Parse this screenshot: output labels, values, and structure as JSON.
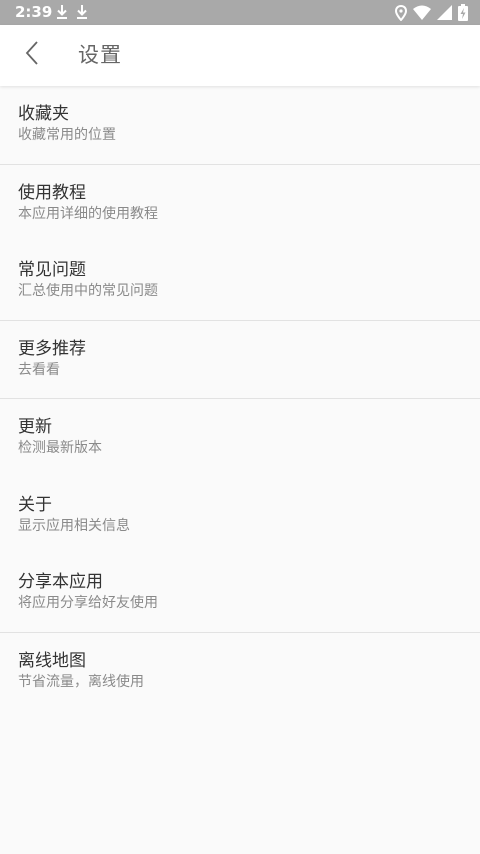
{
  "status_bar": {
    "time": "2:39",
    "left_icons": [
      "download-icon",
      "download-icon"
    ],
    "right_icons": [
      "location-icon",
      "wifi-icon",
      "signal-icon",
      "battery-charging-icon"
    ]
  },
  "header": {
    "title": "设置",
    "back_icon": "back-arrow-icon"
  },
  "settings": [
    {
      "title": "收藏夹",
      "subtitle": "收藏常用的位置"
    },
    {
      "title": "使用教程",
      "subtitle": "本应用详细的使用教程"
    },
    {
      "title": "常见问题",
      "subtitle": "汇总使用中的常见问题"
    },
    {
      "title": "更多推荐",
      "subtitle": "去看看"
    },
    {
      "title": "更新",
      "subtitle": "检测最新版本"
    },
    {
      "title": "关于",
      "subtitle": "显示应用相关信息"
    },
    {
      "title": "分享本应用",
      "subtitle": "将应用分享给好友使用"
    },
    {
      "title": "离线地图",
      "subtitle": "节省流量，离线使用"
    }
  ],
  "colors": {
    "status_bar": "#a9a9a9",
    "background": "#fafafa",
    "app_bar": "#ffffff",
    "title_text": "#333333",
    "subtitle_text": "#8a8a8a",
    "divider": "#e2e2e2"
  }
}
